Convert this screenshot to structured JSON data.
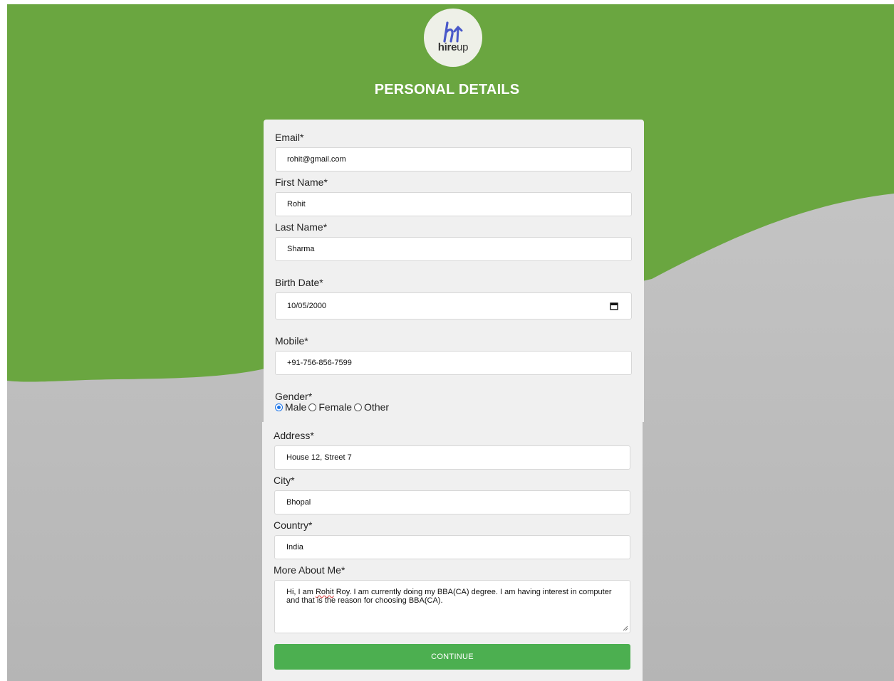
{
  "logo": {
    "brand_bold": "hire",
    "brand_light": "up"
  },
  "page_title": "PERSONAL DETAILS",
  "form": {
    "email": {
      "label": "Email*",
      "value": "rohit@gmail.com"
    },
    "first_name": {
      "label": "First Name*",
      "value": "Rohit"
    },
    "last_name": {
      "label": "Last Name*",
      "value": "Sharma"
    },
    "birth_date": {
      "label": "Birth Date*",
      "value": "10/05/2000",
      "icon": "calendar-icon"
    },
    "mobile": {
      "label": "Mobile*",
      "value": "+91-756-856-7599"
    },
    "gender": {
      "label": "Gender*",
      "options": [
        "Male",
        "Female",
        "Other"
      ],
      "selected": "Male"
    },
    "address": {
      "label": "Address*",
      "value": "House 12, Street 7"
    },
    "city": {
      "label": "City*",
      "value": "Bhopal"
    },
    "country": {
      "label": "Country*",
      "value": "India"
    },
    "about": {
      "label": "More About Me*",
      "value_pre": "Hi, I am ",
      "value_flagged": "Rohit",
      "value_post": " Roy. I am currently doing my BBA(CA) degree. I am having interest in computer and that is the reason for choosing BBA(CA)."
    },
    "continue_label": "CONTINUE"
  },
  "colors": {
    "brand_green": "#6aa640",
    "button_green": "#4caf50",
    "card_bg": "#f0f0f0",
    "radio_accent": "#1a73e8"
  }
}
